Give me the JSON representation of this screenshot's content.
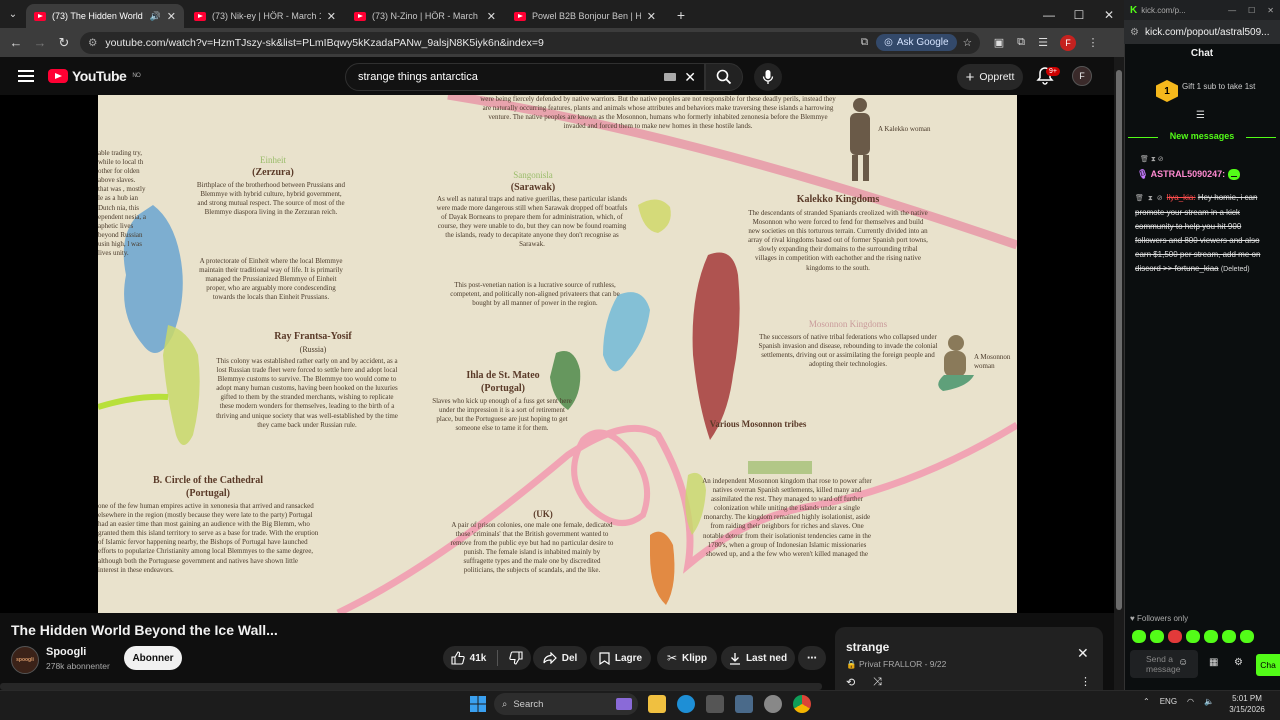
{
  "browser": {
    "tabs": [
      {
        "title": "(73) The Hidden World Beyo",
        "active": true
      },
      {
        "title": "(73) Nik-ey | HÖR - March 16 /",
        "active": false
      },
      {
        "title": "(73) N-Zino | HÖR - March 16 /",
        "active": false
      },
      {
        "title": "Powel B2B Bonjour Ben | HÖR",
        "active": false
      }
    ],
    "url": "youtube.com/watch?v=HzmTJszy-sk&list=PLmIBqwy5kKzadaPANw_9alsjN8K5iyk6n&index=9",
    "ask_google": "Ask Google",
    "profile_letter": "F"
  },
  "youtube": {
    "logo": "YouTube",
    "region": "NO",
    "search_value": "strange things antarctica",
    "create_label": "Opprett",
    "notif_count": "9+",
    "avatar_letter": "F",
    "video_title": "The Hidden World Beyond the Ice Wall...",
    "channel": {
      "name": "Spoogli",
      "subscribers": "278k abonnenter",
      "avatar_text": "spoogli"
    },
    "subscribe_label": "Abonner",
    "actions": {
      "likes": "41k",
      "share": "Del",
      "save": "Lagre",
      "clip": "Klipp",
      "download": "Last ned"
    },
    "playlist": {
      "title": "strange",
      "meta": "Privat FRALLOR - 9/22"
    }
  },
  "map": {
    "headers": [
      {
        "id": "einheit",
        "text": "Einheit"
      },
      {
        "id": "zerzura",
        "text": "(Zerzura)"
      },
      {
        "id": "sangonisla",
        "text": "Sangonisla"
      },
      {
        "id": "sarawak",
        "text": "(Sarawak)"
      },
      {
        "id": "kalekko",
        "text": "Kalekko Kingdoms"
      },
      {
        "id": "rayfrantsa",
        "text": "Ray Frantsa-Yosif"
      },
      {
        "id": "russia",
        "text": "(Russia)"
      },
      {
        "id": "ihla",
        "text": "Ihla de St. Mateo"
      },
      {
        "id": "portugal1",
        "text": "(Portugal)"
      },
      {
        "id": "mosonnon",
        "text": "Mosonnon Kingdoms"
      },
      {
        "id": "various",
        "text": "Various Mosonnon tribes"
      },
      {
        "id": "circle",
        "text": "B. Circle of the Cathedral"
      },
      {
        "id": "portugal2",
        "text": "(Portugal)"
      },
      {
        "id": "uk",
        "text": "(UK)"
      }
    ],
    "captions": {
      "kalekko_woman": "A Kalekko woman",
      "mosonnon_woman": "A Mosonnon woman"
    },
    "paragraphs": {
      "top": "were being fiercely defended by native warriors. But the native peoples are not responsible for these deadly perils, instead they are naturally occurring features, plants and animals whose attributes and behaviors make traversing these islands a harrowing venture. The native peoples are known as the Mosonnon, humans who formerly inhabited zenonesia before the Blemmye invaded and forced them to make new homes in these hostile lands.",
      "einheit": "Birthplace of the brotherhood between Prussians and Blemmye with hybrid culture, hybrid government, and strong mutual respect. The source of most of the Blemmye diaspora living in the Zerzuran reich.",
      "protectorate": "A protectorate of Einheit where the local Blemmye maintain their traditional way of life. It is primarily managed the Prussianized Blemmye of Einheit proper, who are arguably more condescending towards the locals than Einheit Prussians.",
      "sarawak": "As well as natural traps and native guerillas, these particular islands were made more dangerous still when Sarawak dropped off boatfuls of Dayak Borneans to prepare them for administration, which, of course, they were unable to do, but they can now be found roaming the islands, ready to decapitate anyone they don't recognise as Sarawak.",
      "kalekko": "The descendants of stranded Spaniards creolized with the native Mosonnon who were forced to fend for themselves and build new societies on this torturous terrain. Currently divided into an array of rival kingdoms based out of former Spanish port towns, slowly expanding their domains to the surrounding tribal villages in competition with eachother and the rising native kingdoms to the south.",
      "venetian": "This post-venetian nation is a lucrative source of ruthless, competent, and politically non-aligned privateers that can be bought by all manner of power in the region.",
      "russia": "This colony was established rather early on and by accident, as a lost Russian trade fleet were forced to settle here and adopt local Blemmye customs to survive. The Blemmye too would come to adopt many human customs, having been hooked on the luxuries gifted to them by the stranded merchants, wishing to replicate these modern wonders for themselves, leading to the birth of a thriving and unique society that was well-established by the time they came back under Russian rule.",
      "ihla": "Slaves who kick up enough of a fuss get sent here under the impression it is a sort of retirement place, but the Portuguese are just hoping to get someone else to tame it for them.",
      "mosonnon": "The successors of native tribal federations who collapsed under Spanish invasion and disease, rebounding to invade the colonial settlements, driving out or assimilating the foreign people and adopting their technologies.",
      "circle": "one of the few human empires active in xenonesia that arrived and ransacked elsewhere in the region (mostly because they were late to the party) Portugal had an easier time than most gaining an audience with the Big Blemm, who granted them this island territory to serve as a base for trade. With the eruption of Islamic fervor happening nearby, the Bishops of Portugal have launched efforts to popularize Christianity among local Blemmyes to the same degree, although both the Portuguese government and natives have shown little interest in these endeavors.",
      "uk": "A pair of prison colonies, one male one female, dedicated those 'criminals' that the British government wanted to remove from the public eye but had no particular desire to punish. The female island is inhabited mainly by suffragette types and the male one by discredited politicians, the subjects of scandals, and the like.",
      "east": "An independent Mosonnon kingdom that rose to power after natives overran Spanish settlements, killed many and assimilated the rest. They managed to ward off further colonization while uniting the islands under a single monarchy. The kingdom remained highly isolationist, aside from raiding their neighbors for riches and slaves. One notable detour from their isolationist tendencies came in the 1780's, when a group of Indonesian Islamic missionaries showed up, and a the few who weren't killed managed the",
      "left_edge": "able trading try, while to local th other for olden above slaves. that was , mostly le as a hub ian Dutch nia, this ependent nesia, a aphetic lives beyond Russian usin high, l was lives unity."
    }
  },
  "kick": {
    "url": "kick.com/p...",
    "popout_url": "kick.com/popout/astral509...",
    "chat_title": "Chat",
    "gift_count": "1",
    "gift_text": "Gift 1 sub to take 1st",
    "new_messages": "New messages",
    "msg1_user": "ASTRAL5090247:",
    "msg2_user": "liya_kia:",
    "msg2_text": "Hey homie, i can promote your stream in a kick community to help you hit 900 followers and 800 viewers and also earn $1,500 per stream, add me on discord >> fortune_kiaa",
    "msg2_deleted": "(Deleted)",
    "followers_only": "Followers only",
    "send_placeholder": "Send a message",
    "chat_button": "Cha"
  },
  "taskbar": {
    "search": "Search",
    "lang": "ENG",
    "time": "5:01 PM",
    "date": "3/15/2026"
  }
}
